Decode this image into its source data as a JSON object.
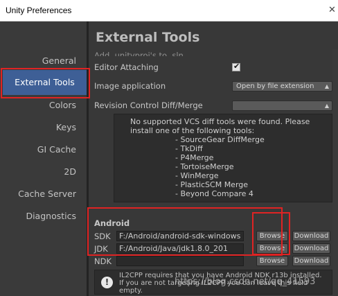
{
  "window": {
    "title": "Unity Preferences"
  },
  "sidebar": {
    "items": [
      {
        "label": "General"
      },
      {
        "label": "External Tools"
      },
      {
        "label": "Colors"
      },
      {
        "label": "Keys"
      },
      {
        "label": "GI Cache"
      },
      {
        "label": "2D"
      },
      {
        "label": "Cache Server"
      },
      {
        "label": "Diagnostics"
      }
    ],
    "selected": "External Tools"
  },
  "main": {
    "title": "External Tools",
    "cut_off_row": "Add .unityproj's to .sln",
    "editor_attaching": {
      "label": "Editor Attaching",
      "checked": true,
      "checkmark": "✔"
    },
    "image_application": {
      "label": "Image application",
      "value": "Open by file extension"
    },
    "revision_control": {
      "label": "Revision Control Diff/Merge",
      "value": ""
    },
    "diff_help": {
      "lines": [
        "No supported VCS diff tools were found. Please",
        "install one of the following tools:",
        "- SourceGear DiffMerge",
        "- TkDiff",
        "- P4Merge",
        "- TortoiseMerge",
        "- WinMerge",
        "- PlasticSCM Merge",
        "- Beyond Compare 4"
      ]
    },
    "android": {
      "section_title": "Android",
      "sdk": {
        "label": "SDK",
        "path": "F:/Android/android-sdk-windows",
        "browse": "Browse",
        "download": "Download"
      },
      "jdk": {
        "label": "JDK",
        "path": "F:/Android/Java/jdk1.8.0_201",
        "browse": "Browse",
        "download": "Download"
      },
      "ndk": {
        "label": "NDK",
        "path": "",
        "browse": "Browse",
        "download": "Download"
      }
    },
    "il2cpp_warning": {
      "icon": "!",
      "lines": [
        "IL2CPP requires that you have Android NDK r13b installed.",
        "If you are not targeting IL2CPP you can leave this field",
        "empty."
      ]
    }
  },
  "watermark": "https://blog.csdn.net/qq_41593",
  "colors": {
    "selection": "#3e5f96",
    "annotation_red": "#e02323"
  }
}
